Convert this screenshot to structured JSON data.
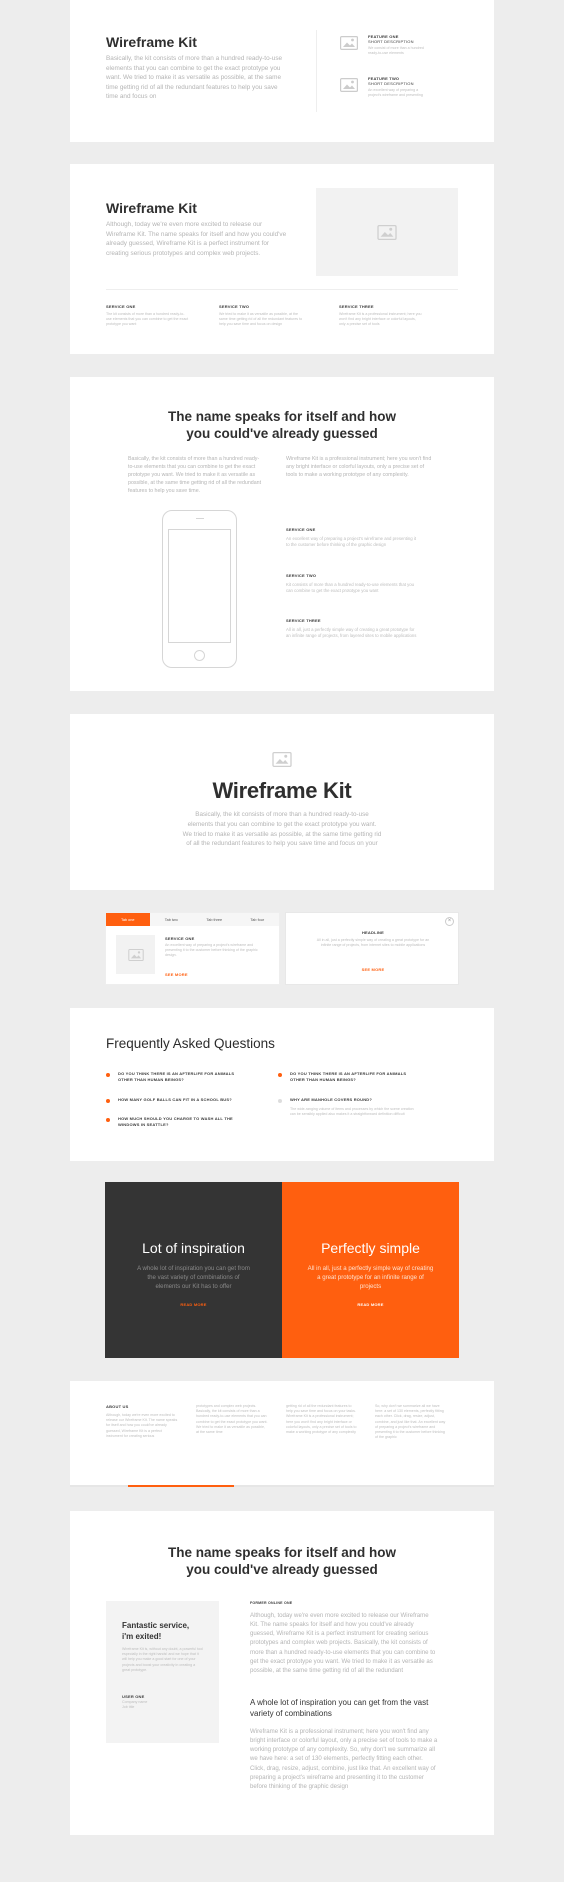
{
  "colors": {
    "accent": "#ff5f0f",
    "dark": "#343434",
    "page_bg": "#ededed"
  },
  "s1": {
    "title": "Wireframe Kit",
    "body": "Basically, the kit consists of more than a hundred ready-to-use elements that you can combine to get the exact prototype you want. We tried to make it as versatile as possible, at the same time getting rid of all the redundant features to help you save time and focus on",
    "features": [
      {
        "title": "FEATURE ONE",
        "subtitle": "SHORT DESCRIPTION",
        "desc": "We consist of more than a hundred ready-to-use elements"
      },
      {
        "title": "FEATURE TWO",
        "subtitle": "SHORT DESCRIPTION",
        "desc": "An excellent way of preparing a project's wireframe and presenting"
      }
    ]
  },
  "s2": {
    "title": "Wireframe Kit",
    "body": "Although, today we're even more excited to release our Wireframe Kit. The name speaks for itself and how you could've already guessed, Wireframe Kit is a perfect instrument for creating serious prototypes and complex web projects.",
    "services": [
      {
        "title": "SERVICE ONE",
        "desc": "The kit consists of more than a hundred ready-to-use elements that you can combine to get the exact prototype you want"
      },
      {
        "title": "SERVICE TWO",
        "desc": "We tried to make it as versatile as possible, at the same time getting rid of all the redundant features to help you save time and focus on design"
      },
      {
        "title": "SERVICE THREE",
        "desc": "Wireframe Kit is a professional instrument; here you won't find any bright interface or colorful layouts, only a precise set of tools"
      }
    ]
  },
  "s3": {
    "title_l1": "The name speaks for itself and how",
    "title_l2": "you could've already guessed",
    "col1": "Basically, the kit consists of more than a hundred ready-to-use elements that you can combine to get the exact prototype you want. We tried to make it as versatile as possible, at the same time getting rid of all the redundant features to help you save time.",
    "col2": "Wireframe Kit is a professional instrument; here you won't find any bright interface or colorful layouts, only a precise set of tools to make a working prototype of any complexity.",
    "services": [
      {
        "title": "SERVICE ONE",
        "desc": "An excellent way of preparing a project's wireframe and presenting it to the customer before thinking of the graphic design"
      },
      {
        "title": "SERVICE TWO",
        "desc": "Kit consists of more than a hundred ready-to-use elements that you can combine to get the exact prototype you want"
      },
      {
        "title": "SERVICE THREE",
        "desc": "All in all, just a perfectly simple way of creating a great prototype for an infinite range of projects, from layered sites to mobile applications"
      }
    ]
  },
  "s4": {
    "title": "Wireframe Kit",
    "body_l1": "Basically, the kit consists of more than a hundred ready-to-use",
    "body_l2": "elements that you can combine to get the exact prototype you want.",
    "body_l3": "We tried to make it as versatile as possible, at the same time getting rid",
    "body_l4": "of all the redundant features to help you save time and focus on your"
  },
  "s5": {
    "tabs": [
      "Tab one",
      "Tab two",
      "Tab three",
      "Tab four"
    ],
    "tab_title": "SERVICE ONE",
    "tab_desc": "An excellent way of preparing a project's wireframe and presenting it to the customer before thinking of the graphic design.",
    "tab_link": "SEE MORE",
    "right_title": "HEADLINE",
    "right_desc": "All in all, just a perfectly simple way of creating a great prototype for an infinite range of projects, from internet sites to mobile applications",
    "right_link": "SEE MORE",
    "close": "×"
  },
  "s6": {
    "title": "Frequently Asked Questions",
    "left": [
      "DO YOU THINK THERE IS AN AFTERLIFE FOR ANIMALS OTHER THAN HUMAN BEINGS?",
      "HOW MANY GOLF BALLS CAN FIT IN A SCHOOL BUS?",
      "HOW MUCH SHOULD YOU CHARGE TO WASH ALL THE WINDOWS IN SEATTLE?"
    ],
    "right": [
      "DO YOU THINK THERE IS AN AFTERLIFE FOR ANIMALS OTHER THAN HUMAN BEINGS?",
      "WHY ARE MANHOLE COVERS ROUND?"
    ],
    "answer": "The wide-ranging volume of items and processes by which the scene creation can be sensibly applied also makes it a straightforward definition difficult"
  },
  "s7": {
    "left_title": "Lot of inspiration",
    "left_body": "A whole lot of inspiration you can get from the vast variety of combinations of elements our Kit has to offer",
    "left_link": "READ MORE",
    "right_title": "Perfectly simple",
    "right_body": "All in all, just a perfectly simple way of creating a great prototype for an infinite range of projects",
    "right_link": "READ MORE"
  },
  "s8": {
    "heading": "ABOUT US",
    "col1": "Although, today we're even more excited to release our Wireframe Kit. The name speaks for itself and how you could've already guessed, Wireframe Kit is a perfect instrument for creating serious",
    "col2": "prototypes and complex web projects. Basically, the kit consists of more than a hundred ready-to-use elements that you can combine to get the exact prototype you want. We tried to make it as versatile as possible, at the same time",
    "col3": "getting rid of all the redundant features to help you save time and focus on your tasks. Wireframe Kit is a professional instrument; here you won't find any bright interface or colorful layouts, only a precise set of tools to make a working prototype of any complexity",
    "col4": "So, why don't we summarize all we have here: a set of 130 elements, perfectly fitting each other. Click, drag, resize, adjust, combine, and just like that. An excellent way of preparing a project's wireframe and presenting it to the customer before thinking of the graphic"
  },
  "s9": {
    "title_l1": "The name speaks for itself and how",
    "title_l2": "you could've already guessed",
    "quote_title_l1": "Fantastic service,",
    "quote_title_l2": "i'm exited!",
    "quote_body": "Wireframe Kit is, without any doubt, a powerful tool especially in the right hands! and we hope that it will help you make a good start for one of your projects and boost your creativity in creating a great prototype.",
    "user_label": "USER ONE",
    "user_meta": "Company name",
    "user_meta2": "Job title",
    "label": "FORMER ONLINE ONE",
    "para1": "Although, today we're even more excited to release our Wireframe Kit. The name speaks for itself and how you could've already guessed, Wireframe Kit is a perfect instrument for creating serious prototypes and complex web projects. Basically, the kit consists of more than a hundred ready-to-use elements that you can combine to get the exact prototype you want. We tried to make it as versatile as possible, at the same time getting rid of all the redundant",
    "subtitle": "A whole lot of inspiration you can get from the vast variety of combinations",
    "para2": "Wireframe Kit is a professional instrument; here you won't find any bright interface or colorful layout, only a precise set of tools to make a working prototype of any complexity. So, why don't we summarize all we have here: a set of 130 elements, perfectly fitting each other. Click, drag, resize, adjust, combine, just like that. An excellent way of preparing a project's wireframe and presenting it to the customer before thinking of the graphic design"
  }
}
